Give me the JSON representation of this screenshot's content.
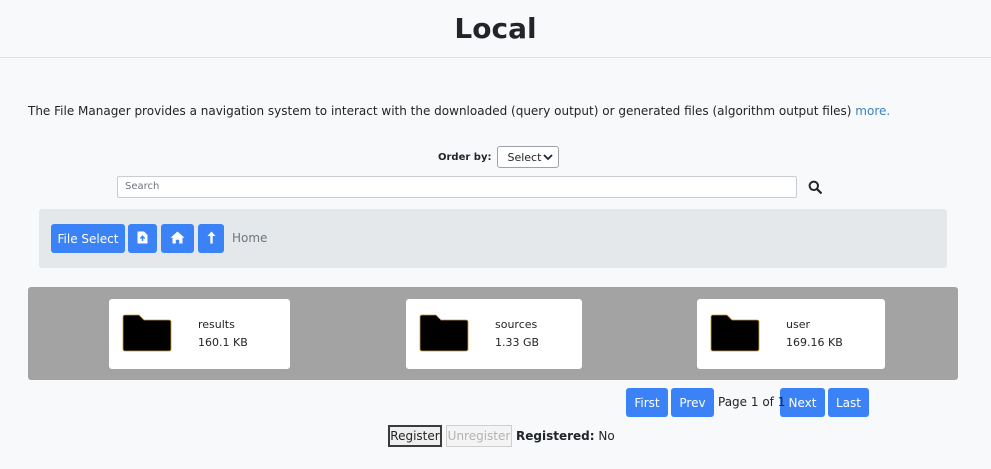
{
  "page": {
    "title": "Local"
  },
  "description": {
    "text": "The File Manager provides a navigation system to interact with the downloaded (query output) or generated files (algorithm output files) ",
    "link": "more."
  },
  "order": {
    "label": "Order by:",
    "selected": "Select"
  },
  "search": {
    "placeholder": "Search"
  },
  "toolbar": {
    "file_select_label": "File Select",
    "breadcrumb": "Home"
  },
  "files": [
    {
      "name": "results",
      "size": "160.1 KB"
    },
    {
      "name": "sources",
      "size": "1.33 GB"
    },
    {
      "name": "user",
      "size": "169.16 KB"
    }
  ],
  "pagination": {
    "first": "First",
    "prev": "Prev",
    "info": "Page 1 of 1",
    "next": "Next",
    "last": "Last"
  },
  "registration": {
    "register_label": "Register",
    "unregister_label": "Unregister",
    "status_label": "Registered:",
    "status_value": "No"
  },
  "colors": {
    "primary": "#3b82f6",
    "link": "#3b82c4",
    "grid_bg": "#a3a3a3"
  }
}
